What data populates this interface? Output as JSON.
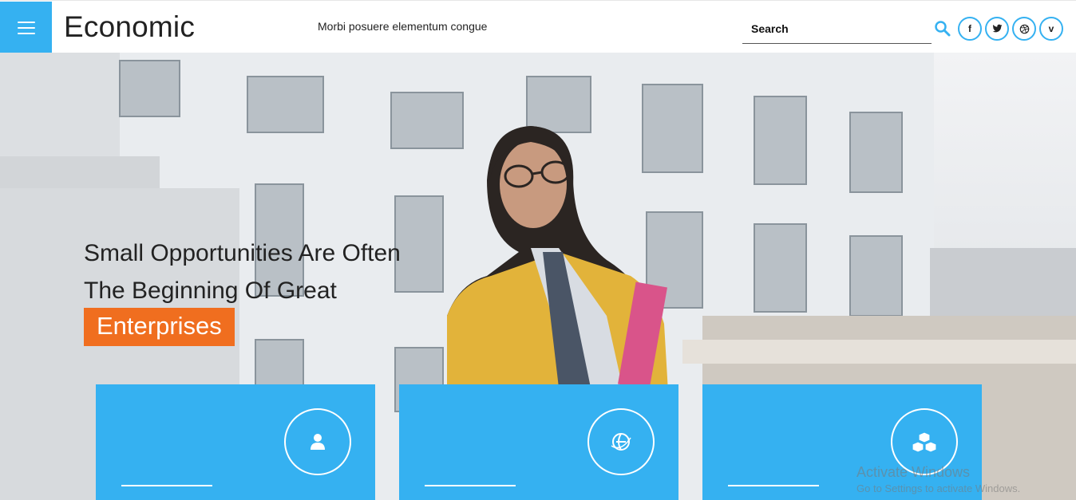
{
  "header": {
    "logo": "Economic",
    "tagline": "Morbi posuere elementum congue",
    "search_placeholder": "Search",
    "search_icon": "search-icon",
    "socials": [
      {
        "name": "facebook-icon",
        "glyph": "f"
      },
      {
        "name": "twitter-icon",
        "glyph": "t"
      },
      {
        "name": "dribbble-icon",
        "glyph": "◎"
      },
      {
        "name": "vimeo-icon",
        "glyph": "v"
      }
    ]
  },
  "hero": {
    "title_line1": "Small Opportunities Are Often",
    "title_line2": "The Beginning Of Great",
    "highlight": "Enterprises"
  },
  "cards": [
    {
      "icon": "user-icon"
    },
    {
      "icon": "globe-icon"
    },
    {
      "icon": "cubes-icon"
    }
  ],
  "watermark": {
    "line1": "Activate Windows",
    "line2": "Go to Settings to activate Windows."
  },
  "colors": {
    "accent": "#35b1f1",
    "highlight": "#f06e1f"
  }
}
